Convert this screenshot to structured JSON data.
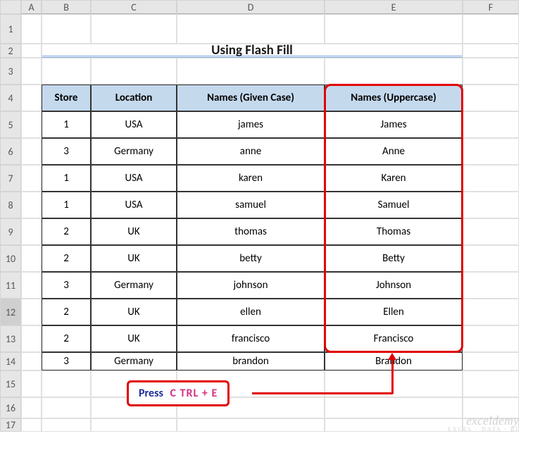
{
  "columns": [
    "A",
    "B",
    "C",
    "D",
    "E",
    "F"
  ],
  "rows": [
    "1",
    "2",
    "3",
    "4",
    "5",
    "6",
    "7",
    "8",
    "9",
    "10",
    "11",
    "12",
    "13",
    "14",
    "15",
    "16",
    "17"
  ],
  "title": "Using Flash Fill",
  "headers": {
    "store": "Store",
    "location": "Location",
    "given": "Names (Given Case)",
    "upper": "Names (Uppercase)"
  },
  "data": [
    {
      "store": "1",
      "location": "USA",
      "given": "james",
      "upper": "James"
    },
    {
      "store": "3",
      "location": "Germany",
      "given": "anne",
      "upper": "Anne"
    },
    {
      "store": "1",
      "location": "USA",
      "given": "karen",
      "upper": "Karen"
    },
    {
      "store": "1",
      "location": "USA",
      "given": "samuel",
      "upper": "Samuel"
    },
    {
      "store": "2",
      "location": "UK",
      "given": "thomas",
      "upper": "Thomas"
    },
    {
      "store": "2",
      "location": "UK",
      "given": "betty",
      "upper": "Betty"
    },
    {
      "store": "3",
      "location": "Germany",
      "given": "johnson",
      "upper": "Johnson"
    },
    {
      "store": "2",
      "location": "UK",
      "given": "ellen",
      "upper": "Ellen"
    },
    {
      "store": "2",
      "location": "UK",
      "given": "francisco",
      "upper": "Francisco"
    },
    {
      "store": "3",
      "location": "Germany",
      "given": "brandon",
      "upper": "Brandon"
    }
  ],
  "callout": {
    "label": "Press",
    "key": "C TRL + E"
  },
  "watermark": {
    "main": "exceldemy",
    "sub": "EXCEL · DATA · BI"
  },
  "selected_row": "12"
}
